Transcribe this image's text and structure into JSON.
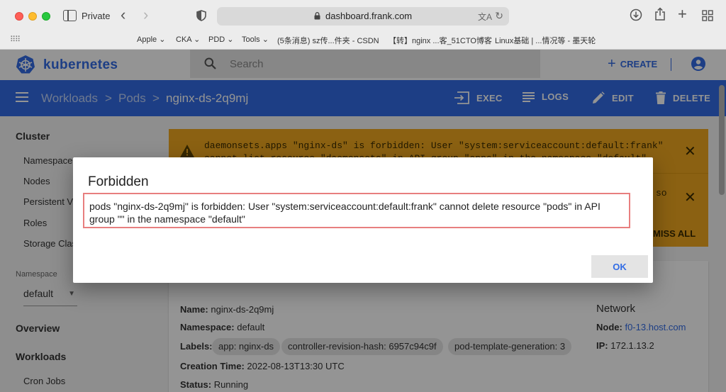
{
  "browser": {
    "private_label": "Private",
    "url": "dashboard.frank.com",
    "translate_glyph": "文A",
    "bookmarks": [
      "Apple ⌄",
      "CKA ⌄",
      "PDD ⌄",
      "Tools ⌄",
      "(5条消息) sz传...件夹 - CSDN",
      "【转】nginx ...客_51CTO博客",
      "Linux基础 | ...情况等 - 墨天轮"
    ]
  },
  "header": {
    "brand": "kubernetes",
    "search_placeholder": "Search",
    "create_label": "CREATE",
    "brand_color": "#326ce5"
  },
  "action_bar": {
    "breadcrumb": [
      "Workloads",
      "Pods",
      "nginx-ds-2q9mj"
    ],
    "separator": ">",
    "actions": [
      "EXEC",
      "LOGS",
      "EDIT",
      "DELETE"
    ]
  },
  "sidebar": {
    "cluster_heading": "Cluster",
    "cluster_items": [
      "Namespace",
      "Nodes",
      "Persistent V",
      "Roles",
      "Storage Clas"
    ],
    "namespace_label": "Namespace",
    "namespace_value": "default",
    "overview": "Overview",
    "workloads": "Workloads",
    "workload_items": [
      "Cron Jobs"
    ]
  },
  "alerts": [
    {
      "line1": "daemonsets.apps \"nginx-ds\" is forbidden: User \"system:serviceaccount:default:frank\"",
      "line2": "cannot list resource \"daemonsets\" in API group \"apps\" in the namespace \"default\"",
      "tail": "so"
    }
  ],
  "dismiss_all": "MISS ALL",
  "pod": {
    "name_label": "Name:",
    "name": "nginx-ds-2q9mj",
    "namespace_label": "Namespace:",
    "namespace": "default",
    "labels_label": "Labels:",
    "labels": [
      "app: nginx-ds",
      "controller-revision-hash: 6957c94c9f",
      "pod-template-generation: 3"
    ],
    "creation_label": "Creation Time:",
    "creation": "2022-08-13T13:30 UTC",
    "status_label": "Status:",
    "status": "Running"
  },
  "network": {
    "title": "Network",
    "node_label": "Node:",
    "node": "f0-13.host.com",
    "ip_label": "IP:",
    "ip": "172.1.13.2"
  },
  "dialog": {
    "title": "Forbidden",
    "message": "pods \"nginx-ds-2q9mj\" is forbidden: User \"system:serviceaccount:default:frank\" cannot delete resource \"pods\" in API group \"\" in the namespace \"default\"",
    "ok_label": "OK"
  }
}
